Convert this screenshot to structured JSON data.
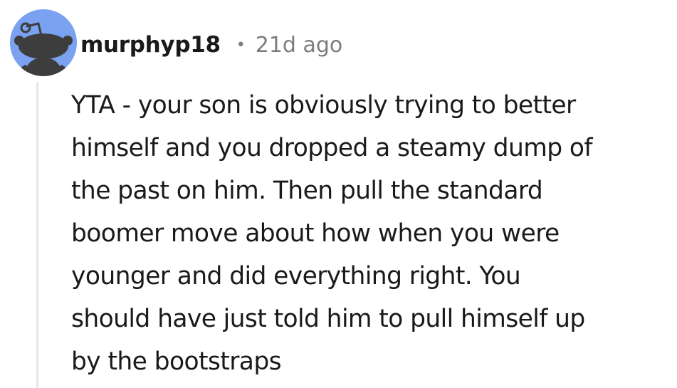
{
  "comment": {
    "author": "murphyp18",
    "separator": "•",
    "age": "21d ago",
    "body_lines": [
      "YTA - your son is obviously trying to better",
      "himself and you dropped a steamy dump of",
      "the past on him. Then pull the standard",
      "boomer move about how when you were",
      "younger and did everything right. You",
      "should have just told him to pull himself up",
      "by the bootstraps"
    ]
  },
  "avatar": {
    "icon": "snoo-avatar-icon",
    "background_color": "#7aa2f0",
    "figure_color": "#3d3d3d"
  },
  "colors": {
    "text": "#1a1a1b",
    "meta": "#7c7c7c",
    "thread_line": "#e6e6e6"
  }
}
